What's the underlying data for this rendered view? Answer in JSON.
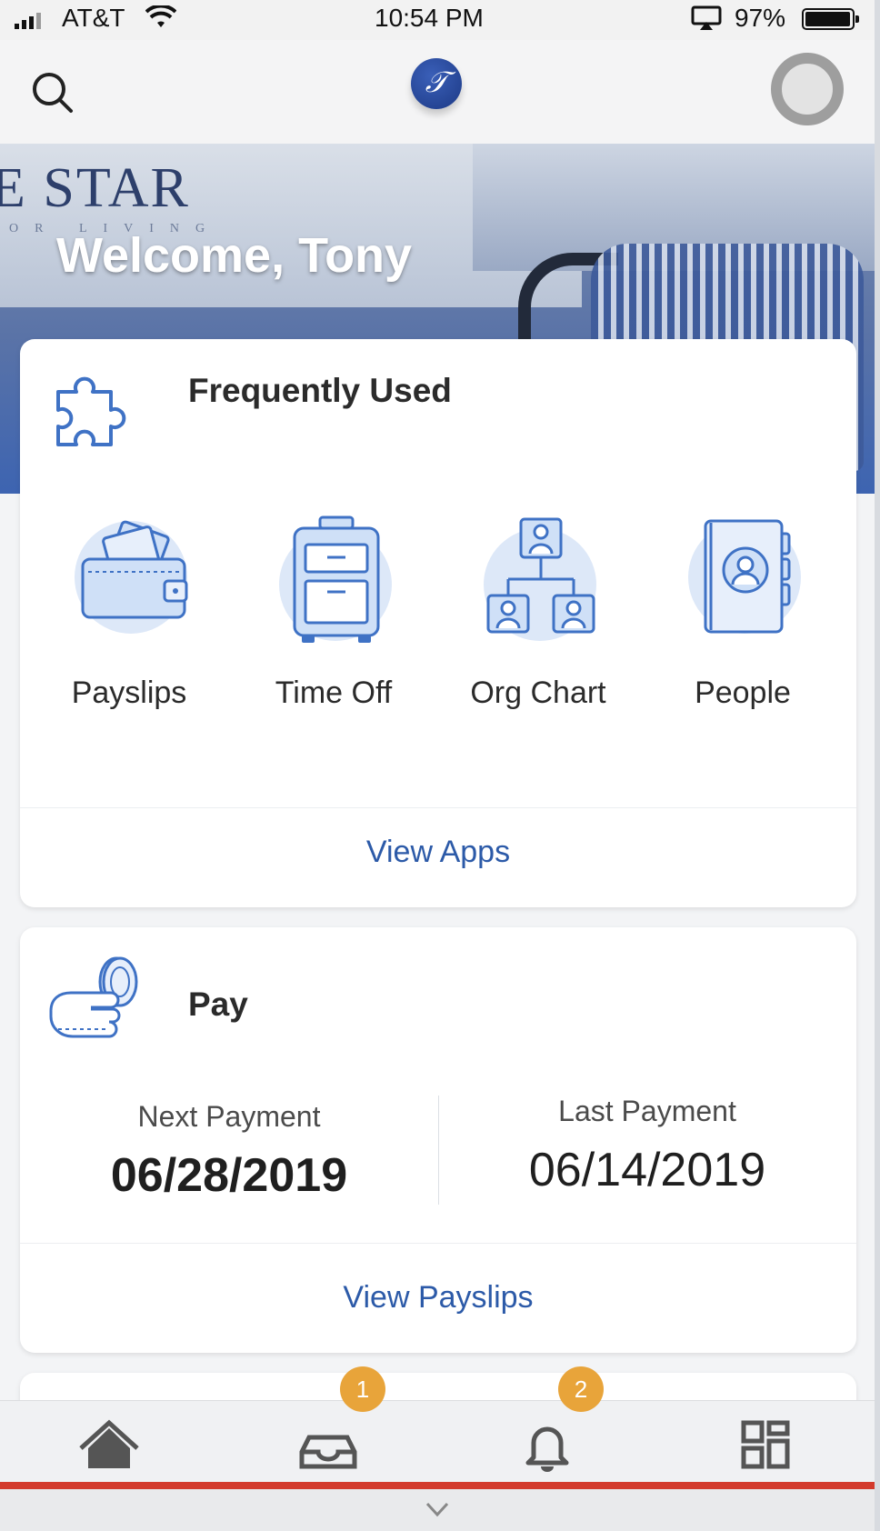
{
  "status_bar": {
    "carrier": "AT&T",
    "time": "10:54 PM",
    "battery": "97%",
    "battery_level": 0.97
  },
  "header": {
    "logo_text": "𝒯",
    "icons": [
      "search-icon",
      "company-logo",
      "avatar"
    ]
  },
  "hero": {
    "brand_text": "E STAR",
    "brand_sub": "OR LIVING",
    "welcome": "Welcome, Tony"
  },
  "frequently_used": {
    "title": "Frequently Used",
    "icon": "puzzle-icon",
    "apps": [
      {
        "label": "Payslips",
        "icon": "wallet-icon"
      },
      {
        "label": "Time Off",
        "icon": "suitcase-icon"
      },
      {
        "label": "Org Chart",
        "icon": "org-chart-icon"
      },
      {
        "label": "People",
        "icon": "address-book-icon"
      }
    ],
    "link": "View Apps"
  },
  "pay": {
    "title": "Pay",
    "icon": "hand-coins-icon",
    "next_label": "Next Payment",
    "next_value": "06/28/2019",
    "last_label": "Last Payment",
    "last_value": "06/14/2019",
    "link": "View Payslips"
  },
  "bottom_nav": {
    "items": [
      {
        "icon": "home-icon"
      },
      {
        "icon": "inbox-icon",
        "badge": "1"
      },
      {
        "icon": "bell-icon",
        "badge": "2"
      },
      {
        "icon": "apps-grid-icon"
      }
    ]
  },
  "colors": {
    "accent": "#2c5aa8",
    "badge": "#e8a43a",
    "progress": "#d33a2c",
    "icon_blue": "#3f72c5",
    "icon_fill": "#cfe0f7"
  }
}
